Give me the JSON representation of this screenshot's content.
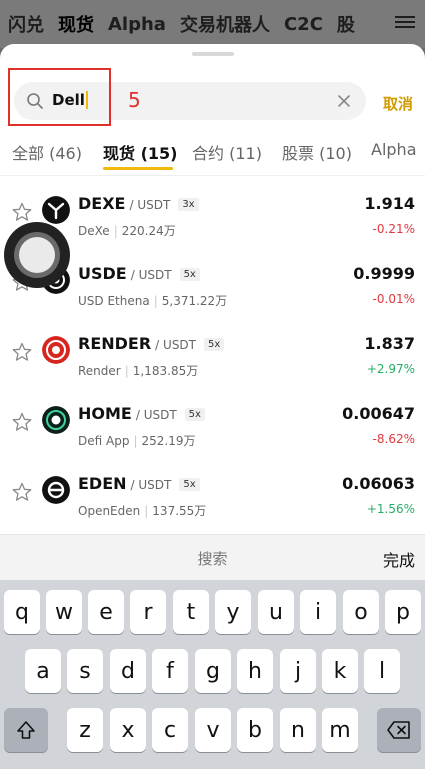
{
  "nav": {
    "items": [
      "闪兑",
      "现货",
      "Alpha",
      "交易机器人",
      "C2C",
      "股"
    ],
    "active_index": 1
  },
  "search": {
    "value": "Dell",
    "cancel_label": "取消",
    "annotation_number": "5"
  },
  "tabs": [
    {
      "label": "全部 (46)"
    },
    {
      "label": "现货 (15)"
    },
    {
      "label": "合约 (11)"
    },
    {
      "label": "股票 (10)"
    },
    {
      "label": "Alpha"
    }
  ],
  "active_tab": 1,
  "pairs": [
    {
      "symbol": "DEXE",
      "quote": "/ USDT",
      "leverage": "3x",
      "name": "DeXe",
      "volume": "220.24万",
      "price": "1.914",
      "change": "-0.21%",
      "direction": "neg",
      "icon": "dexe-logo-icon"
    },
    {
      "symbol": "USDE",
      "quote": "/ USDT",
      "leverage": "5x",
      "name": "USD Ethena",
      "volume": "5,371.22万",
      "price": "0.9999",
      "change": "-0.01%",
      "direction": "neg",
      "icon": "usde-logo-icon"
    },
    {
      "symbol": "RENDER",
      "quote": "/ USDT",
      "leverage": "5x",
      "name": "Render",
      "volume": "1,183.85万",
      "price": "1.837",
      "change": "+2.97%",
      "direction": "pos",
      "icon": "render-logo-icon"
    },
    {
      "symbol": "HOME",
      "quote": "/ USDT",
      "leverage": "5x",
      "name": "Defi App",
      "volume": "252.19万",
      "price": "0.00647",
      "change": "-8.62%",
      "direction": "neg",
      "icon": "home-logo-icon"
    },
    {
      "symbol": "EDEN",
      "quote": "/ USDT",
      "leverage": "5x",
      "name": "OpenEden",
      "volume": "137.55万",
      "price": "0.06063",
      "change": "+1.56%",
      "direction": "pos",
      "icon": "eden-logo-icon"
    }
  ],
  "keyboard": {
    "placeholder": "搜索",
    "done_label": "完成",
    "row1": [
      "q",
      "w",
      "e",
      "r",
      "t",
      "y",
      "u",
      "i",
      "o",
      "p"
    ],
    "row2": [
      "a",
      "s",
      "d",
      "f",
      "g",
      "h",
      "j",
      "k",
      "l"
    ],
    "row3": [
      "z",
      "x",
      "c",
      "v",
      "b",
      "n",
      "m"
    ]
  },
  "colors": {
    "accent": "#f0b90b",
    "negative": "#e0393e",
    "positive": "#24ae64",
    "annotation": "#e0302a"
  }
}
